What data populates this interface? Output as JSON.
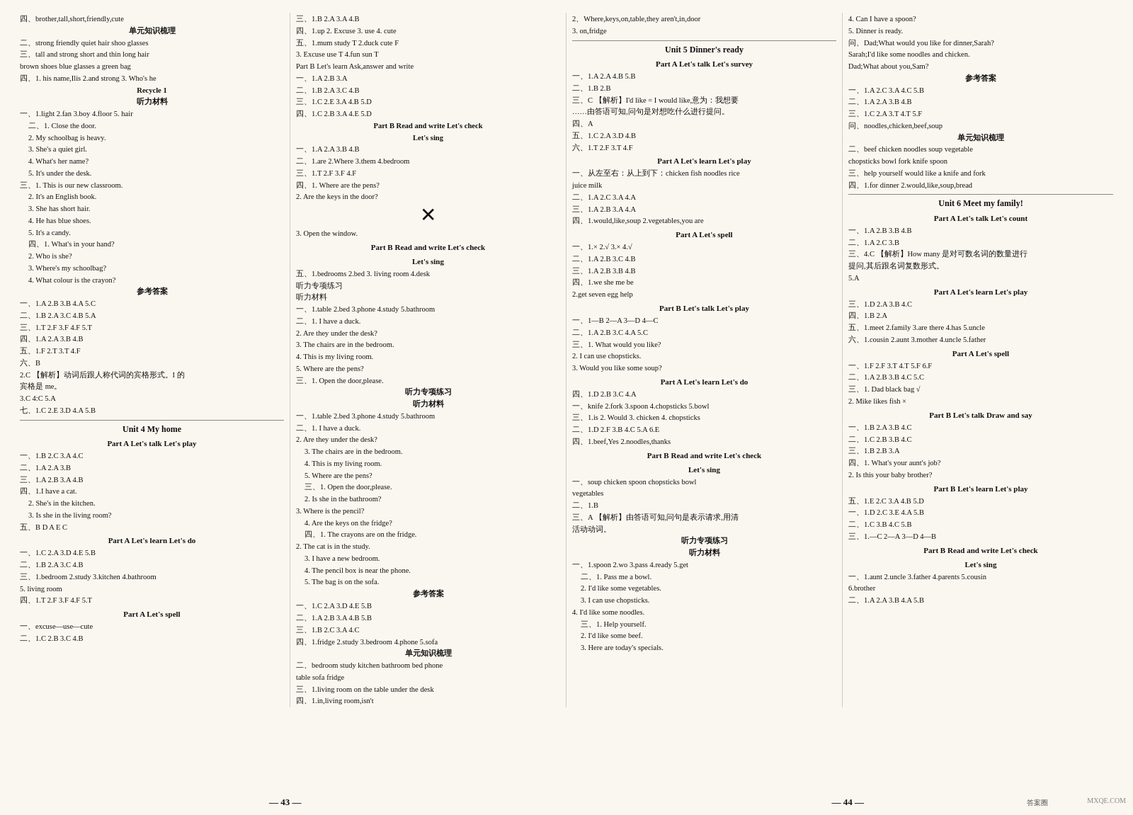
{
  "page": {
    "left": "— 43 —",
    "right": "— 44 —",
    "watermark": "MXQE.COM",
    "logo": "答案圈"
  },
  "col1": {
    "line1": "四、brother,tall,short,friendly,cute",
    "title1": "单元知识梳理",
    "line2": "二、strong  friendly  quiet  hair  shoo  glasses",
    "line3": "三、tall and strong  short and thin  long hair",
    "line4": "    brown shoes  blue glasses  a green bag",
    "line5": "四、1. his name,Ilis  2.and strong  3. Who's he",
    "recycle": "Recycle 1",
    "listen": "听力材料",
    "l1": "一、1.light  2.fan  3.boy  4.floor  5. hair",
    "l2": "二、1. Close the door.",
    "l3": "    2. My schoolbag is heavy.",
    "l4": "    3. She's a quiet girl.",
    "l5": "    4. What's her name?",
    "l6": "    5. It's under the desk.",
    "l7": "三、1. This is our new classroom.",
    "l8": "    2. It's an English book.",
    "l9": "    3. She has short hair.",
    "l10": "    4. He has blue shoes.",
    "l11": "    5. It's a candy.",
    "l12": "四、1. What's in your hand?",
    "l13": "",
    "l14": "    2. Who is she?",
    "l15": "    3. Where's my schoolbag?",
    "l16": "    4. What colour is the crayon?",
    "l17": "",
    "l18": "",
    "l19": "",
    "l20": "",
    "l21": "",
    "l22": "",
    "l23": "",
    "l24": "",
    "ans": "参考答案",
    "a1": "一、1.A  2.B  3.B  4.A  5.C",
    "a2": "二、1.B  2.A  3.C  4.B  5.A",
    "a3": "三、1.T  2.F  3.F  4.F  5.T",
    "a4": "四、1.A  2.A  3.B  4.B",
    "a5": "五、1.F  2.T  3.T  4.F",
    "a6": "六、B",
    "a7": "    2.C  【解析】动词后跟人称代词的宾格形式。I 的",
    "a8": "    宾格是 me。",
    "a9": "    3.C  4:C  5.A",
    "a10": "七、1.C  2.E  3.D  4.A  5.B",
    "unit4": "Unit 4  My home",
    "unit4sub": "Part A  Let's talk  Let's play",
    "u4l1": "一、1.B  2.C  3.A  4.C",
    "u4l2": "二、1.A  2.A  3.B",
    "u4l3": "三、1.A  2.B  3.A  4.B",
    "u4l4": "四、1.I have a cat.",
    "u4l5": "    2. She's in the kitchen.",
    "u4l6": "    3. Is she in the living room?",
    "u4l7": "",
    "u4l8": "五、B  D  A  E  C",
    "parta_learn": "Part A  Let's learn  Let's do",
    "pl1": "一、1.C  2.A  3.D  4.E  5.B",
    "pl2": "二、1.B  2.A  3.C  4.B",
    "pl3": "三、1.bedroom  2.study  3.kitchen  4.bathroom",
    "pl4": "    5. living room",
    "pl5": "四、1.T  2.F  3.F  4.F  5.T",
    "parta_spell": "Part A  Let's spell",
    "ps1": "一、excuse—use—cute",
    "ps2": "二、1.C  2.B  3.C  4.B"
  },
  "col2": {
    "line1": "三、1.B  2.A  3.A  4.B",
    "line2": "四、1.up  2. Excuse  3. use  4. cute",
    "line3": "五、1.mum  study  T  2.duck  cute  F",
    "line4": "    3. Excuse  use  T  4.fun  sun  T",
    "line5": "    Part B  Let's learn  Ask,answer and write",
    "line6": "一、1.A  2.B  3.A",
    "line7": "二、1.B  2.A  3.C  4.B",
    "line8": "三、1.C  2.E  3.A  4.B  5.D",
    "line9": "四、1.C  2.B  3.A  4.E  5.D",
    "partb_rw": "Part B  Read and write  Let's check",
    "partb_sing": "Let's sing",
    "s1": "一、1.A  2.A  3.B  4.B",
    "s2": "二、1.are  2.Where  3.them  4.bedroom",
    "s3": "三、1.T  2.F  3.F  4.F",
    "s4": "四、1. Where are the pens?",
    "s5": "    2. Are the keys in the door?",
    "s6": "    3. Open the window.",
    "partb_title": "Part B  Read and write  Let's check",
    "partb_check": "Let's sing",
    "bc1": "五、1.bedrooms  2.bed  3. living room  4.desk",
    "bc2": "    听力专项练习",
    "bc3": "    听力材料",
    "bc4": "一、1.table  2.bed  3.phone  4.study  5.bathroom",
    "bc5": "二、1. I have a duck.",
    "bc6": "    2. Are they under the desk?",
    "bc7": "    3. The chairs are in the bedroom.",
    "bc8": "    4. This is my living room.",
    "bc9": "    5. Where are the pens?",
    "bc10": "三、1. Open the door,please.",
    "listen_special": "听力专项练习",
    "listen_mat": "听力材料",
    "lm1": "一、1.table  2.bed  3.phone  4.study  5.bathroom",
    "lm2": "二、1. I have a duck.",
    "lm3": "    2. Are they under the desk?",
    "lm4": "    3. The chairs are in the bedroom.",
    "lm5": "    4. This is my living room.",
    "lm6": "    5. Where are the pens?",
    "lm7": "三、1. Open the door,please.",
    "lm8": "    2. Is she in the bathroom?",
    "lm9": "    3. Where is the pencil?",
    "lm10": "    4. Are the keys on the fridge?",
    "lm11": "四、1. The crayons are on the fridge.",
    "lm12": "    2. The cat is in the study.",
    "lm13": "    3. I have a new bedroom.",
    "lm14": "    4. The pencil box is near the phone.",
    "lm15": "    5. The bag is on the sofa.",
    "lm16": "",
    "lm17": "",
    "lm18": "",
    "lm19": "",
    "lm20": "",
    "lm21": "",
    "lm22": "",
    "ans": "参考答案",
    "am1": "一、1.C  2.A  3.D  4.E  5.B",
    "am2": "二、1.A  2.B  3.A  4.B  5.B",
    "am3": "三、1.B  2.C  3.A  4.C",
    "am4": "四、1.fridge  2.study  3.bedroom  4.phone  5.sofa",
    "unit_review": "单元知识梳理",
    "ur1": "二、bedroom  study  kitchen  bathroom  bed  phone",
    "ur2": "    table  sofa  fridge",
    "ur3": "三、1.living room on the table  under the desk",
    "ur4": "四、1.in,living room,isn't"
  },
  "col3": {
    "line1": "2、Where,keys,on,table,they aren't,in,door",
    "line2": "3. on,fridge",
    "unit5": "Unit 5  Dinner's ready",
    "unit5sub": "Part A  Let's talk  Let's survey",
    "u5l1": "一、1.A  2.A  4.B  5.B",
    "u5l2": "二、1.B  2.B",
    "u5l3": "三、C  【解析】I'd like = I would like,意为：我想要",
    "u5l4": "    ……由答语可知,问句是对想吃什么进行提问。",
    "u5l5": "四、A",
    "u5l6": "五、1.C  2.A  3.D  4.B",
    "u5l7": "六、1.T  2.F  3.T  4.F",
    "parta_learn_play": "Part A  Let's learn  Let's play",
    "pl1": "一、从左至右：从上到下：chicken  fish  noodles  rice",
    "pl2": "    juice  milk",
    "pl3": "二、1.A  2.C  3.A  4.A",
    "pl4": "三、1.A  2.B  3.A  4.A",
    "pl5": "四、1.would,like,soup  2.vegetables,you are",
    "parta_spell2": "Part A  Let's spell",
    "ps1": "一、1.× 2.√ 3.× 4.√",
    "ps2": "二、1.A  2.B  3.C  4.B",
    "ps3": "三、1.A  2.B  3.B  4.B",
    "ps4": "四、1.we  she  me  be",
    "ps5": "    2.get  seven  egg  help",
    "partb_talk_play": "Part B  Let's talk  Let's play",
    "bt1": "一、1—B  2—A  3—D  4—C",
    "bt2": "二、1.A  2.B  3.C  4.A  5.C",
    "bt3": "三、1. What would you like?",
    "bt4": "    2. I can use chopsticks.",
    "bt5": "    3. Would you like some soup?",
    "parta_learn_do": "Part A  Let's learn  Let's do",
    "ld1": "四、1.D  2.B  3.C  4.A",
    "ld2": "一、knife  2.fork  3.spoon  4.chopsticks  5.bowl",
    "ld3": "三、1.is  2. Would  3. chicken  4. chopsticks",
    "ld4": "二、1.D  2.F  3.B  4.C  5.A  6.E",
    "ld5": "四、1.beef,Yes  2.noodles,thanks",
    "partb_rw_check": "Part B  Read and write  Let's check",
    "letssing": "Let's sing",
    "ls1": "一、soup  chicken  spoon  chopsticks  bowl",
    "ls2": "    vegetables",
    "ls3": "二、1.B",
    "ls4": "三、A  【解析】由答语可知,问句是表示请求,用清",
    "ls5": "    活动动词。",
    "listen_special2": "听力专项练习",
    "listen_mat2": "听力材料",
    "lm1": "一、1.spoon  2.wo  3.pass  4.ready  5.get",
    "lm2": "二、1. Pass me a bowl.",
    "lm3": "    2. I'd like some vegetables.",
    "lm4": "    3. I can use chopsticks.",
    "lm5": "    4. I'd like some noodles.",
    "lm6": "三、1. Help yourself.",
    "lm7": "    2. I'd like some beef.",
    "lm8": "    3. Here are today's specials.",
    "lm9": "",
    "lm10": "",
    "lm11": "",
    "lm12": ""
  },
  "col4": {
    "line1": "4. Can I have a spoon?",
    "line2": "5. Dinner is ready.",
    "line3": "问、Dad;What would you like for dinner,Sarah?",
    "line4": "    Sarah;I'd like some noodles and chicken.",
    "line5": "    Dad;What about you,Sam?",
    "ans": "参考答案",
    "a1": "一、1.A  2.C  3.A  4.C  5.B",
    "a2": "二、1.A  2.A  3.B  4.B",
    "a3": "三、1.C  2.A  3.T  4.T  5.F",
    "a4": "问、noodles,chicken,beef,soup",
    "unit_review": "单元知识梳理",
    "ur1": "二、beef  chicken  noodles  soup  vegetable",
    "ur2": "    chopsticks  bowl  fork  knife  spoon",
    "ur3": "三、help yourself  would like  a knife and fork",
    "ur4": "四、1.for dinner  2.would,like,soup,bread",
    "unit6": "Unit 6  Meet my family!",
    "unit6sub": "Part A  Let's talk  Let's count",
    "u6l1": "一、1.A  2.B  3.B  4.B",
    "u6l2": "二、1.A  2.C  3.B",
    "u6l3": "三、4.C  【解析】How many 是对可数名词的数量进行",
    "u6l4": "    提问,其后跟名词复数形式。",
    "u6l5": "    5.A",
    "parta_learn_play": "Part A  Let's learn  Let's play",
    "pl1": "三、1.D  2.A  3.B  4.C",
    "pl2": "四、1.B  2.A",
    "pl3": "五、1.meet  2.family  3.are there  4.has  5.uncle",
    "pl4": "六、1.cousin  2.aunt  3.mother  4.uncle  5.father",
    "parta_spell": "Part A  Let's spell",
    "ps1": "一、1.F  2.F  3.T  4.T  5.F  6.F",
    "ps2": "二、1.A  2.B  3.B  4.C  5.C",
    "ps3": "三、1. Dad  black  bag  √",
    "ps4": "    2. Mike  likes  fish  ×",
    "partb_talk_draw": "Part B  Let's talk  Draw and say",
    "bd1": "一、1.B  2.A  3.B  4.C",
    "bd2": "二、1.C  2.B  3.B  4.C",
    "bd3": "三、1.B  2.B  3.A",
    "bd4": "四、1. What's your aunt's job?",
    "bd5": "    2. Is this your baby brother?",
    "partb_learn_play": "Part B  Let's learn  Let's play",
    "blp1": "五、1.E  2.C  3.A  4.B  5.D",
    "blp2": "一、1.D  2.C  3.E  4.A  5.B",
    "blp3": "二、1.C  3.B  4.C  5.B",
    "blp4": "三、1.—C  2—A  3—D  4—B",
    "partb_rw_check": "Part B  Read and write  Let's check",
    "letssing": "Let's sing",
    "ls1": "一、1.aunt  2.uncle  3.father  4.parents  5.cousin",
    "ls2": "    6.brother",
    "ls3": "二、1.A  2.A  3.B  4.A  5.B"
  }
}
